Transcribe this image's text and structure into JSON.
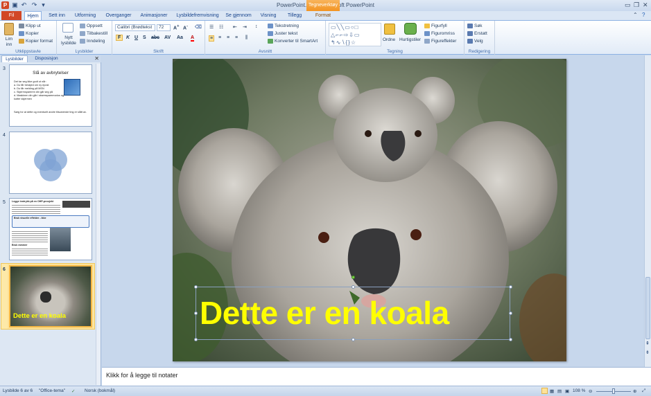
{
  "window": {
    "title": "PowerPoint.pptx  -  Microsoft PowerPoint",
    "contextual_tab_group": "Tegneverktøy"
  },
  "ribbon_tabs": [
    "Fil",
    "Hjem",
    "Sett inn",
    "Utforming",
    "Overganger",
    "Animasjoner",
    "Lysbildefremvisning",
    "Se gjennom",
    "Visning",
    "Tillegg",
    "Format"
  ],
  "ribbon": {
    "clipboard": {
      "paste": "Lim inn",
      "cut": "Klipp ut",
      "copy": "Kopier",
      "format_painter": "Kopier format",
      "label": "Utklippstavle"
    },
    "slides": {
      "new_slide": "Nytt lysbilde",
      "layout": "Oppsett",
      "reset": "Tilbakestill",
      "section": "Inndeling",
      "label": "Lysbilder"
    },
    "font": {
      "font_name": "Calibri (Brødtekst",
      "font_size": "72",
      "label": "Skrift"
    },
    "paragraph": {
      "text_direction": "Tekstretning",
      "align_text": "Juster tekst",
      "smartart": "Konverter til SmartArt",
      "label": "Avsnitt"
    },
    "drawing": {
      "arrange": "Ordne",
      "quick_styles": "Hurtigstiler",
      "shape_fill": "Figurfyll",
      "shape_outline": "Figuromriss",
      "shape_effects": "Figureffekter",
      "label": "Tegning"
    },
    "editing": {
      "find": "Søk",
      "replace": "Erstatt",
      "select": "Velg",
      "label": "Redigering"
    }
  },
  "pane": {
    "tab_slides": "Lysbilder",
    "tab_outline": "Disposisjon",
    "slides": [
      {
        "number": "3",
        "title": "Slå av avbrytelser",
        "intro": "Det tar seg ikke godt ut når:",
        "items": [
          "a.  Du får beskjed om ny epost",
          "b.  Du får melding på MSN",
          "c.  Skjermspareren din går seg på",
          "d.  Maskinen din går i strømsparemodus og kutter skjermen"
        ],
        "footer": "Sørg for at dette og eventuelt andre tilsvarende ting er slått av."
      },
      {
        "number": "4"
      },
      {
        "number": "5",
        "headings": [
          "Legge inntrykk på en OHP-prosjekt",
          "Bruk visuelle effekter - ikke",
          "Bruk rammer"
        ]
      },
      {
        "number": "6",
        "title": "Dette er en koala"
      }
    ]
  },
  "slide": {
    "title": "Dette er en koala"
  },
  "notes": {
    "placeholder": "Klikk for å legge til notater"
  },
  "status": {
    "slide_info": "Lysbilde 6 av 6",
    "theme": "\"Office-tema\"",
    "language": "Norsk (bokmål)",
    "zoom": "108 %"
  }
}
